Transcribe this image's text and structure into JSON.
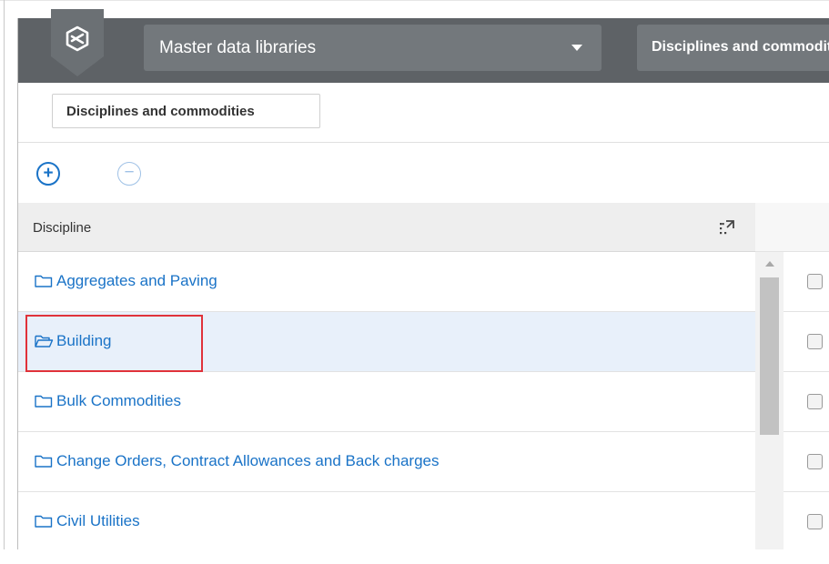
{
  "nav": {
    "library_select": "Master data libraries",
    "active_tab": "Disciplines and commodities"
  },
  "subtab": {
    "label": "Disciplines and commodities"
  },
  "toolbar": {
    "add_symbol": "+",
    "remove_symbol": "−"
  },
  "table": {
    "header": "Discipline",
    "rows": [
      {
        "label": "Aggregates and Paving",
        "icon": "folder-closed-icon",
        "selected": false
      },
      {
        "label": "Building",
        "icon": "folder-open-icon",
        "selected": true
      },
      {
        "label": "Bulk Commodities",
        "icon": "folder-closed-icon",
        "selected": false
      },
      {
        "label": "Change Orders, Contract Allowances and Back charges",
        "icon": "folder-closed-icon",
        "selected": false
      },
      {
        "label": "Civil Utilities",
        "icon": "folder-closed-icon",
        "selected": false
      }
    ]
  },
  "colors": {
    "topbar": "#5e6266",
    "nav_control": "#73787c",
    "link_blue": "#1a73c7",
    "selected_row": "#e8f0fa",
    "highlight_red": "#e0323a"
  }
}
